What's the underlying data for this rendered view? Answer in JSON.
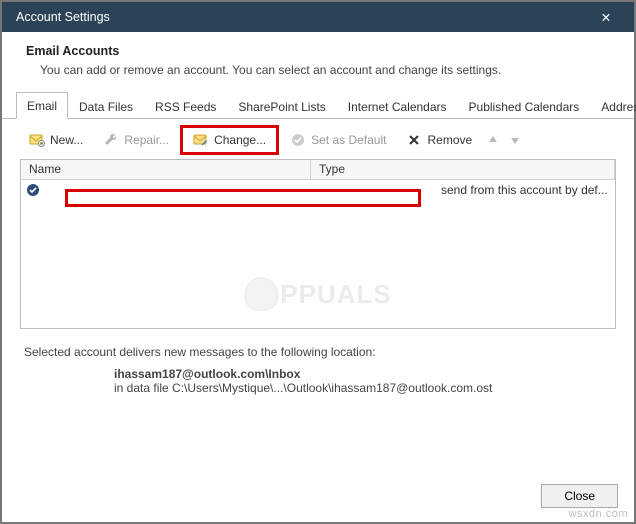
{
  "window": {
    "title": "Account Settings",
    "close_glyph": "✕"
  },
  "header": {
    "title": "Email Accounts",
    "subtitle": "You can add or remove an account. You can select an account and change its settings."
  },
  "tabs": [
    {
      "label": "Email",
      "active": true
    },
    {
      "label": "Data Files"
    },
    {
      "label": "RSS Feeds"
    },
    {
      "label": "SharePoint Lists"
    },
    {
      "label": "Internet Calendars"
    },
    {
      "label": "Published Calendars"
    },
    {
      "label": "Address Books"
    }
  ],
  "toolbar": {
    "new": "New...",
    "repair": "Repair...",
    "change": "Change...",
    "set_default": "Set as Default",
    "remove": "Remove"
  },
  "list": {
    "columns": {
      "name": "Name",
      "type": "Type"
    },
    "row": {
      "type_text": "send from this account by def..."
    }
  },
  "footer": {
    "line1": "Selected account delivers new messages to the following location:",
    "loc_bold": "ihassam187@outlook.com\\Inbox",
    "loc_path": "in data file C:\\Users\\Mystique\\...\\Outlook\\ihassam187@outlook.com.ost"
  },
  "buttons": {
    "close": "Close"
  },
  "watermark": {
    "brand": "PPUALS",
    "site": "wsxdn.com"
  }
}
